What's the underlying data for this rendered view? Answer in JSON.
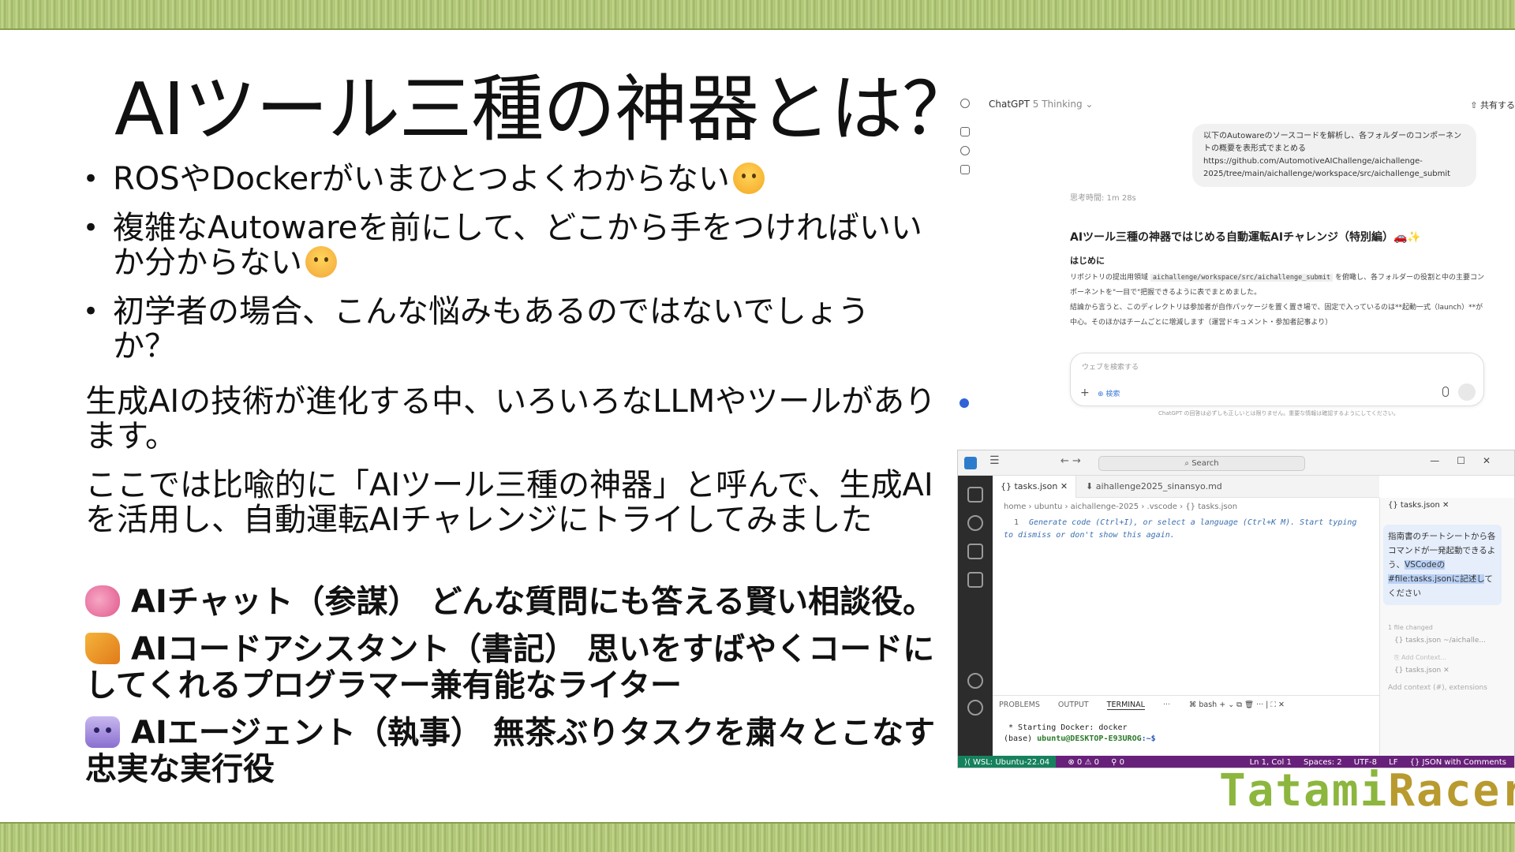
{
  "slide": {
    "title": "AIツール三種の神器とは？",
    "bullets": [
      "ROSやDockerがいまひとつよくわからない",
      "複雑なAutowareを前にして、どこから手をつければいいか分からない",
      "初学者の場合、こんな悩みもあるのではないでしょうか？"
    ],
    "para1": "生成AIの技術が進化する中、いろいろなLLMやツールがあります。",
    "para2": "ここでは比喩的に「AIツール三種の神器」と呼んで、生成AIを活用し、自動運転AIチャレンジにトライしてみました",
    "tools": [
      {
        "icon": "brain-icon",
        "text": "AIチャット（参謀） どんな質問にも答える賢い相談役。"
      },
      {
        "icon": "writing-hand-icon",
        "text": "AIコードアシスタント（書記） 思いをすばやくコードにしてくれるプログラマー兼有能なライター"
      },
      {
        "icon": "robot-icon",
        "text": "AIエージェント（執事） 無茶ぶりタスクを粛々とこなす忠実な実行役"
      }
    ],
    "brand_part1": "Tatami",
    "brand_part2": "Racer"
  },
  "chatgpt": {
    "app": "ChatGPT",
    "model": "5 Thinking ⌄",
    "share": "⇧ 共有する",
    "user_message": "以下のAutowareのソースコードを解析し、各フォルダーのコンポーネントの概要を表形式でまとめる https://github.com/AutomotiveAIChallenge/aichallenge-2025/tree/main/aichallenge/workspace/src/aichallenge_submit",
    "thinking_time": "思考時間: 1m 28s",
    "response_title": "AIツール三種の神器ではじめる自動運転AIチャレンジ（特別編）🚗✨",
    "response_heading": "はじめに",
    "response_line1a": "リポジトリの提出用領域",
    "response_code": "aichallenge/workspace/src/aichallenge_submit",
    "response_line1b": "を俯瞰し、各フォルダーの役割と中の主要コンポーネントを\"一目で\"把握できるように表でまとめました。",
    "response_line2": "結論から言うと、このディレクトリは参加者が自作パッケージを置く置き場で、固定で入っているのは**起動一式（launch）**が中心。そのほかはチームごとに増減します（運営ドキュメント・参加者記事より）",
    "input_placeholder": "ウェブを検索する",
    "input_plus": "+",
    "input_search": "⊕ 検索",
    "footer": "ChatGPT の回答は必ずしも正しいとは限りません。重要な情報は確認するようにしてください。"
  },
  "vscode": {
    "menu": "☰",
    "arrows": "←  →",
    "search": "⌕ Search",
    "window_controls": "—☐✕",
    "tab_active": "{} tasks.json ✕",
    "tab_2": "⬇ aihallenge2025_sinansyo.md",
    "breadcrumb": "home › ubuntu › aichallenge-2025 › .vscode › {} tasks.json",
    "line_number": "1",
    "ghost_text": "Generate code (Ctrl+I), or select a language (Ctrl+K M). Start typing to dismiss or don't show this again.",
    "side_tab": "{} tasks.json ✕",
    "chat_text_1": "指南書のチートシートから各コマンドが一発起動できるよう、",
    "chat_text_hl": "VSCodeの#file:tasks.jsonに記述し",
    "chat_text_2": "てください",
    "files_changed": "1 file changed",
    "file_item_1": "{} tasks.json ~/aichalle...",
    "add_context_button": "⎘ Add Context...",
    "file_item_2": "{} tasks.json ✕",
    "context_placeholder": "Add context (#), extensions",
    "panel_tabs": [
      "PROBLEMS",
      "OUTPUT",
      "TERMINAL",
      "···"
    ],
    "bash_label": "⌘ bash + ⌄  ⧉ 🗑 ··· | ⛶ ✕",
    "terminal_line1": " * Starting Docker: docker",
    "terminal_prompt_base": "(base) ",
    "terminal_prompt_user": "ubuntu@DESKTOP-E93UROG",
    "terminal_prompt_path": ":~$",
    "status_wsl": "⟩⟨ WSL: Ubuntu-22.04",
    "status_errors": "⊗ 0 ⚠ 0",
    "status_ports": "⚲ 0",
    "status_right": [
      "Ln 1, Col 1",
      "Spaces: 2",
      "UTF-8",
      "LF",
      "{} JSON with Comments"
    ]
  }
}
